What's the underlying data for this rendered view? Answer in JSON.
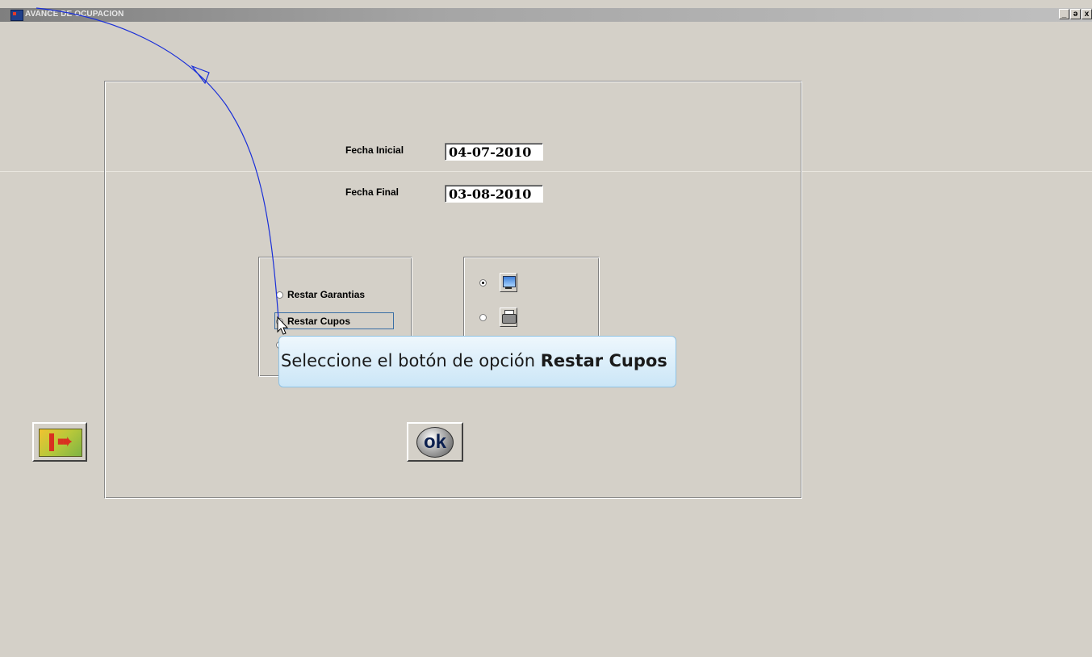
{
  "window": {
    "title": "AVANCE DE OCUPACION",
    "minimize": "_",
    "restore": "ǝ",
    "close": "x"
  },
  "form": {
    "fecha_inicial_label": "Fecha Inicial",
    "fecha_inicial_value": "04-07-2010",
    "fecha_final_label": "Fecha Final",
    "fecha_final_value": "03-08-2010"
  },
  "options": {
    "restar_garantias_label": "Restar Garantias",
    "restar_cupos_label": "Restar Cupos"
  },
  "output": {
    "screen_icon": "monitor-icon",
    "printer_icon": "printer-icon"
  },
  "buttons": {
    "ok_label": "ok",
    "exit_icon": "exit-door-icon"
  },
  "callout": {
    "text_prefix": "Seleccione el botón de opción ",
    "text_bold": "Restar Cupos"
  }
}
